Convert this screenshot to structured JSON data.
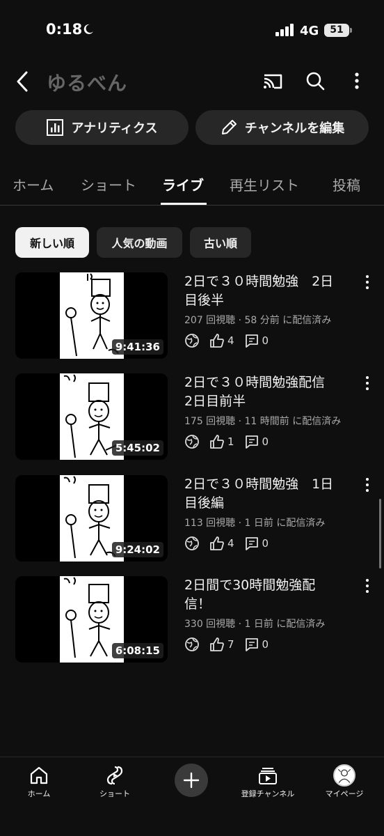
{
  "status_bar": {
    "time": "0:18",
    "network": "4G",
    "battery": "51"
  },
  "header": {
    "channel_name": "ゆるべん"
  },
  "actions": {
    "analytics_label": "アナリティクス",
    "edit_channel_label": "チャンネルを編集"
  },
  "tabs": [
    "ホーム",
    "ショート",
    "ライブ",
    "再生リスト",
    "投稿"
  ],
  "active_tab": "ライブ",
  "chips": [
    "新しい順",
    "人気の動画",
    "古い順"
  ],
  "selected_chip": "新しい順",
  "videos": [
    {
      "title_line1": "2日で３０時間勉強　2日",
      "title_line2": "目後半",
      "meta": "207 回視聴 · 58 分前 に配信済み",
      "duration": "9:41:36",
      "likes": "4",
      "comments": "0"
    },
    {
      "title_line1": "2日で３０時間勉強配信",
      "title_line2": "2日目前半",
      "meta": "175 回視聴 · 11 時間前 に配信済み",
      "duration": "5:45:02",
      "likes": "1",
      "comments": "0"
    },
    {
      "title_line1": "2日で３０時間勉強　1日",
      "title_line2": "目後編",
      "meta": "113 回視聴 · 1 日前 に配信済み",
      "duration": "9:24:02",
      "likes": "4",
      "comments": "0"
    },
    {
      "title_line1": "2日間で30時間勉強配",
      "title_line2": "信！",
      "meta": "330 回視聴 · 1 日前 に配信済み",
      "duration": "6:08:15",
      "likes": "7",
      "comments": "0"
    }
  ],
  "bottom_nav": {
    "home": "ホーム",
    "shorts": "ショート",
    "subscriptions": "登録チャンネル",
    "mypage": "マイページ"
  },
  "colors": {
    "background": "#0f0f0f",
    "chip": "#272727",
    "text_primary": "#f1f1f1",
    "text_secondary": "#aaaaaa"
  }
}
